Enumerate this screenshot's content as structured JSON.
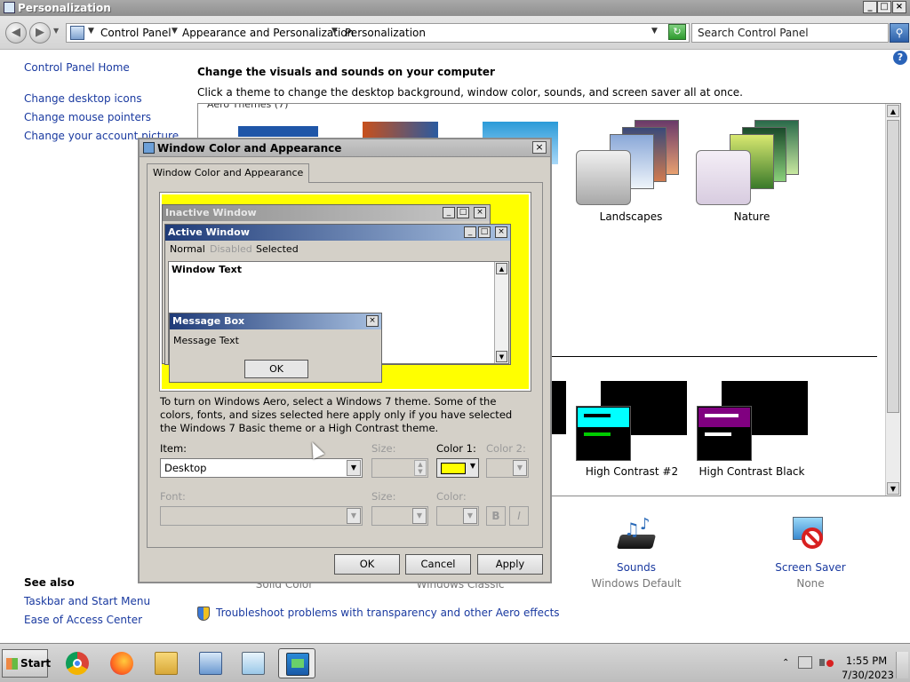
{
  "window": {
    "title": "Personalization"
  },
  "address": {
    "segments": [
      "Control Panel",
      "Appearance and Personalization",
      "Personalization"
    ],
    "search_placeholder": "Search Control Panel"
  },
  "left_pane": {
    "home": "Control Panel Home",
    "links": [
      "Change desktop icons",
      "Change mouse pointers",
      "Change your account picture"
    ],
    "see_also_title": "See also",
    "see_also": [
      "Taskbar and Start Menu",
      "Ease of Access Center"
    ]
  },
  "main": {
    "heading": "Change the visuals and sounds on your computer",
    "subheading": "Click a theme to change the desktop background, window color, sounds, and screen saver all at once.",
    "aero_header": "Aero Themes (7)",
    "themes_top": [
      "Landscapes",
      "Nature"
    ],
    "themes_bottom": [
      "High Contrast #2",
      "High Contrast Black"
    ],
    "bottom_items": [
      {
        "label": "Solid Color",
        "sub": ""
      },
      {
        "label": "Windows Classic",
        "sub": ""
      },
      {
        "label": "Sounds",
        "sub": "Windows Default"
      },
      {
        "label": "Screen Saver",
        "sub": "None"
      }
    ],
    "troubleshoot": "Troubleshoot problems with transparency and other Aero effects",
    "help_glyph": "?"
  },
  "dialog": {
    "title": "Window Color and Appearance",
    "tab": "Window Color and Appearance",
    "preview": {
      "inactive_title": "Inactive Window",
      "active_title": "Active Window",
      "menu": [
        "Normal",
        "Disabled",
        "Selected"
      ],
      "window_text": "Window Text",
      "msgbox_title": "Message Box",
      "msgbox_text": "Message Text",
      "msgbox_ok": "OK"
    },
    "aero_help": "To turn on Windows Aero, select a Windows 7 theme.  Some of the colors, fonts, and sizes selected here apply only if you have selected the Windows 7 Basic theme or a High Contrast theme.",
    "labels": {
      "item": "Item:",
      "size": "Size:",
      "color1": "Color 1:",
      "color2": "Color 2:",
      "font": "Font:",
      "font_size": "Size:",
      "font_color": "Color:",
      "bold": "B",
      "italic": "I"
    },
    "item_value": "Desktop",
    "color1_value": "#ffff00",
    "buttons": {
      "ok": "OK",
      "cancel": "Cancel",
      "apply": "Apply"
    }
  },
  "taskbar": {
    "start": "Start",
    "time": "1:55 PM",
    "date": "7/30/2023",
    "apps": [
      "chrome-icon",
      "firefox-icon",
      "file-explorer-icon",
      "control-panel-icon",
      "notepad-icon",
      "personalization-icon"
    ]
  },
  "colors": {
    "accent_yellow": "#ffff00",
    "active_title": "#1f3b78",
    "inactive_title": "#8e8e8e",
    "hc_cyan": "#00ffff",
    "hc_purple": "#800080",
    "link_blue": "#1a3aa0"
  }
}
